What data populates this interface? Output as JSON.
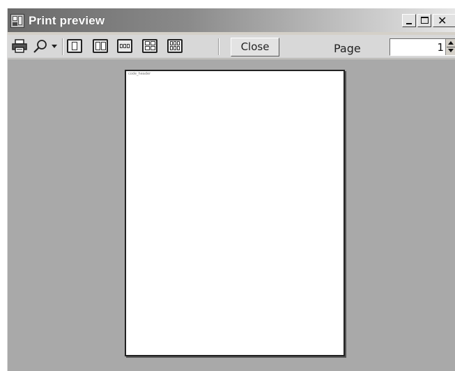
{
  "window": {
    "title": "Print preview",
    "icon": "app-print-preview-icon",
    "caption_buttons": [
      "minimize",
      "maximize",
      "close"
    ]
  },
  "toolbar": {
    "print_icon": "printer-icon",
    "zoom_icon": "magnifier-icon",
    "page_layouts": [
      "one-page",
      "two-pages",
      "three-pages",
      "four-pages",
      "six-pages"
    ],
    "close_label": "Close",
    "page_label": "Page",
    "page_value": "1"
  },
  "preview": {
    "page_header_text": "code_header"
  },
  "colors": {
    "background": "#a9a9a9",
    "toolbar": "#d8d8d8",
    "page": "#ffffff"
  }
}
